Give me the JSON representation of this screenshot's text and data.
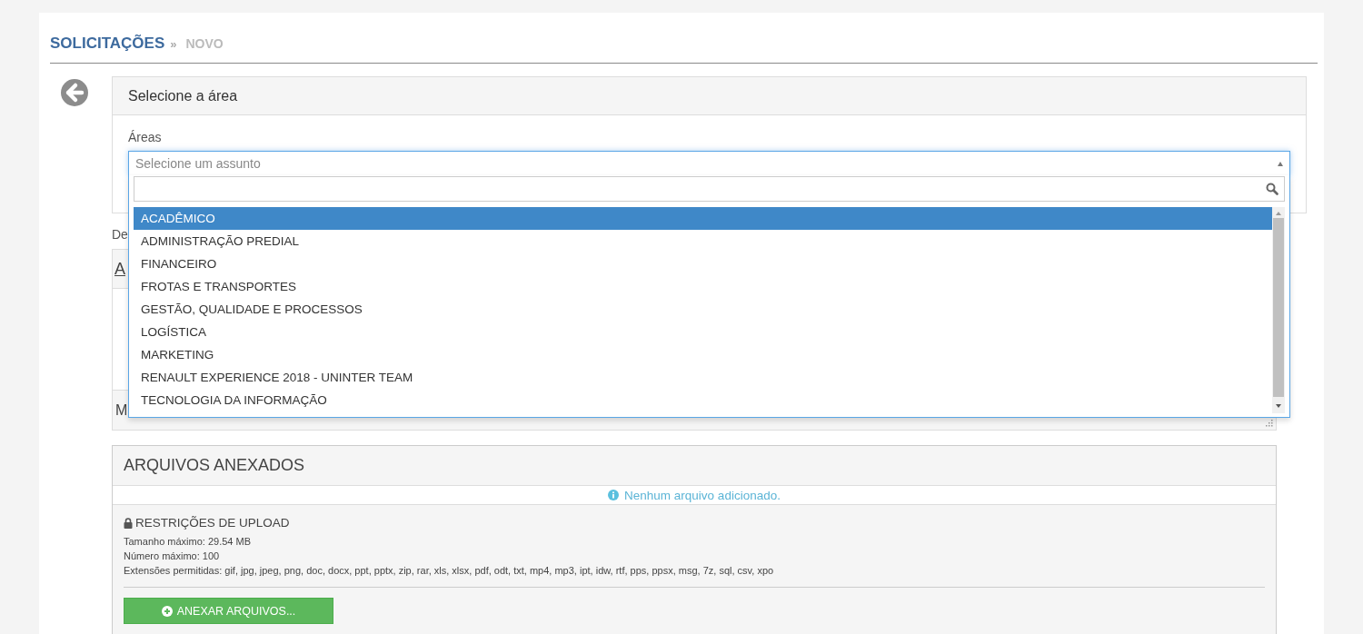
{
  "breadcrumb": {
    "section": "SOLICITAÇÕES",
    "separator": "»",
    "current": "NOVO"
  },
  "area_panel": {
    "title": "Selecione a área",
    "field_label": "Áreas",
    "select": {
      "placeholder": "Selecione um assunto",
      "expanded": true
    },
    "dropdown": {
      "options": [
        {
          "label": "ACADÊMICO",
          "selected": true
        },
        {
          "label": "ADMINISTRAÇÃO PREDIAL",
          "selected": false
        },
        {
          "label": "FINANCEIRO",
          "selected": false
        },
        {
          "label": "FROTAS E TRANSPORTES",
          "selected": false
        },
        {
          "label": "GESTÃO, QUALIDADE E PROCESSOS",
          "selected": false
        },
        {
          "label": "LOGÍSTICA",
          "selected": false
        },
        {
          "label": "MARKETING",
          "selected": false
        },
        {
          "label": "RENAULT EXPERIENCE 2018 - UNINTER TEAM",
          "selected": false
        },
        {
          "label": "TECNOLOGIA DA INFORMAÇÃO",
          "selected": false
        }
      ]
    }
  },
  "hidden_form": {
    "label": "De",
    "panel_header": "A",
    "row_label": "M"
  },
  "attachments": {
    "title": "ARQUIVOS ANEXADOS",
    "info": "Nenhum arquivo adicionado.",
    "restrictions_title": "RESTRIÇÕES DE UPLOAD",
    "restrictions": [
      "Tamanho máximo: 29.54 MB",
      "Número máximo: 100",
      "Extensões permitidas: gif, jpg, jpeg, png, doc, docx, ppt, pptx, zip, rar, xls, xlsx, pdf, odt, txt, mp4, mp3, ipt, idw, rtf, pps, ppsx, msg, 7z, sql, csv, xpo"
    ],
    "button": "ANEXAR ARQUIVOS..."
  }
}
